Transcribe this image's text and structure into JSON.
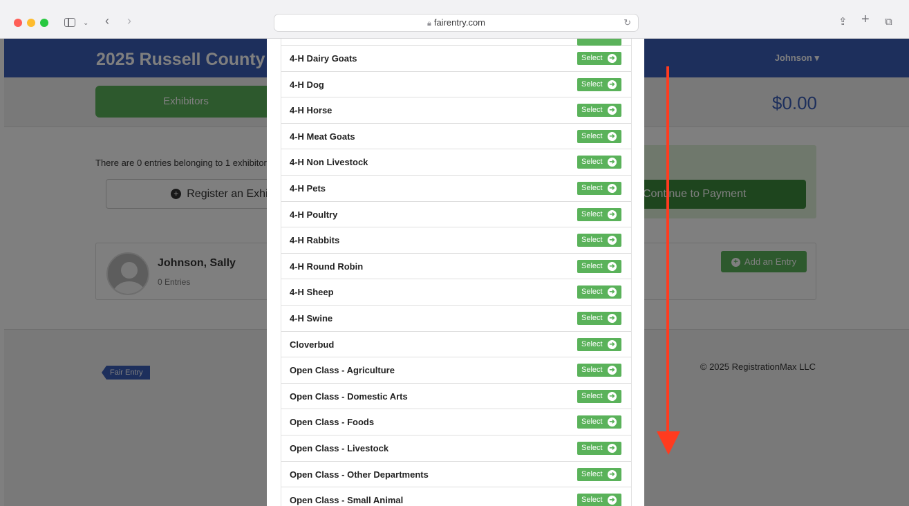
{
  "browser": {
    "url": "fairentry.com"
  },
  "page": {
    "event_title": "2025 Russell County",
    "user_menu": "Johnson ▾",
    "tab_exhibitors": "Exhibitors",
    "total": "$0.00",
    "summary_text": "There are 0 entries belonging to 1 exhibitor",
    "register_button": "Register an Exhibitor",
    "payment_button": "Continue to Payment",
    "exhibitor": {
      "name": "Johnson, Sally",
      "entries": "0 Entries",
      "add_entry_button": "Add an Entry"
    },
    "footer": {
      "logo_text": "Fair Entry",
      "copyright": "© 2025 RegistrationMax LLC"
    }
  },
  "modal": {
    "select_label": "Select",
    "departments": [
      "4-H Dairy Goats",
      "4-H Dog",
      "4-H Horse",
      "4-H Meat Goats",
      "4-H Non Livestock",
      "4-H Pets",
      "4-H Poultry",
      "4-H Rabbits",
      "4-H Round Robin",
      "4-H Sheep",
      "4-H Swine",
      "Cloverbud",
      "Open Class - Agriculture",
      "Open Class - Domestic Arts",
      "Open Class - Foods",
      "Open Class - Livestock",
      "Open Class - Other Departments",
      "Open Class - Small Animal"
    ]
  },
  "annotation": {
    "arrow_color": "#ff3b1f",
    "arrow_direction": "down"
  }
}
